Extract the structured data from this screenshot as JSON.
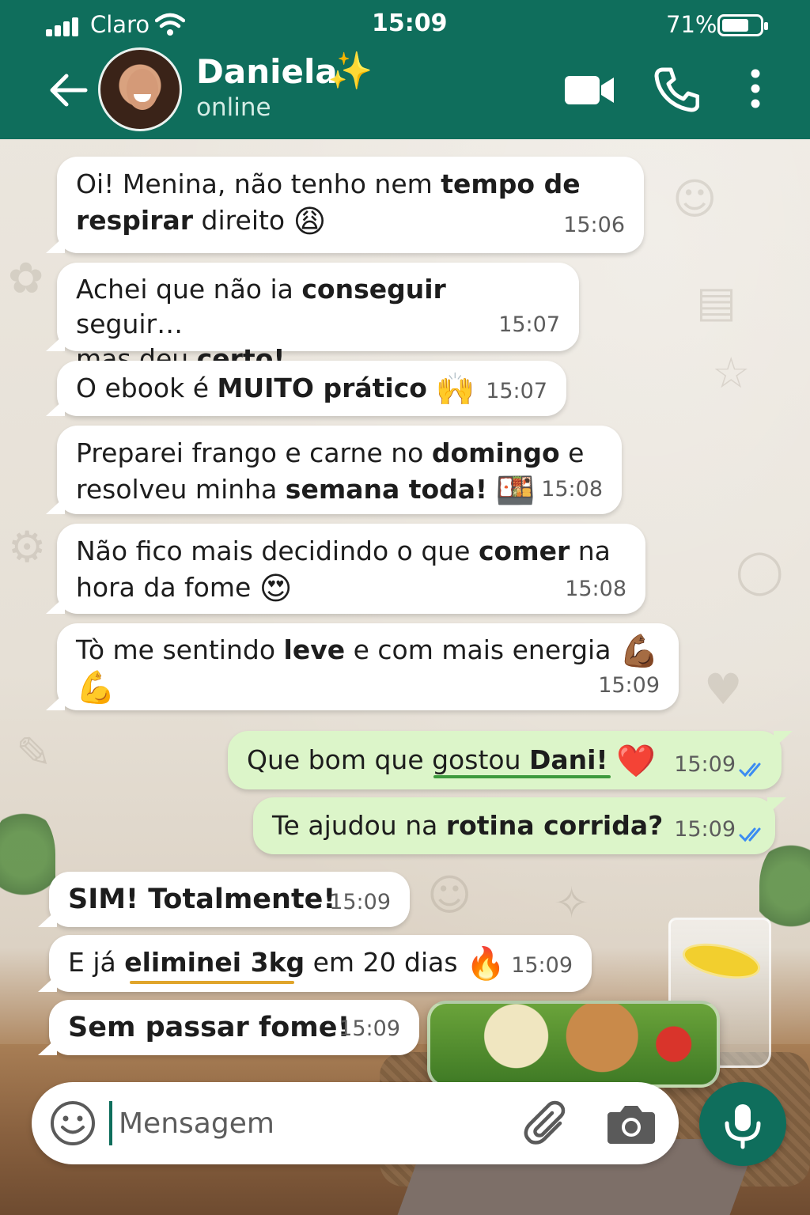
{
  "status_bar": {
    "carrier": "Claro",
    "time": "15:09",
    "battery": "71%",
    "battery_level": 0.71
  },
  "header": {
    "contact_name": "Daniela",
    "name_emoji": "✨",
    "status": "online",
    "icons": [
      "back-arrow-icon",
      "video-camera-icon",
      "phone-icon",
      "more-vertical-icon"
    ]
  },
  "messages": [
    {
      "dir": "in",
      "parts": [
        [
          "Oi! Menina, não tenho nem ",
          false
        ],
        [
          "tempo de",
          true
        ]
      ],
      "line2": [
        [
          "respirar",
          true
        ],
        [
          " direito ",
          false
        ]
      ],
      "emoji": "😩",
      "time": "15:06"
    },
    {
      "dir": "in",
      "line1": [
        [
          "Achei que não ia ",
          false
        ],
        [
          "conseguir",
          true
        ],
        [
          " seguir…",
          false
        ]
      ],
      "line2": [
        [
          "mas deu ",
          false
        ],
        [
          "certo!",
          true
        ]
      ],
      "time": "15:07"
    },
    {
      "dir": "in",
      "line1": [
        [
          "O ebook é ",
          false
        ],
        [
          "MUITO prático",
          true
        ]
      ],
      "emoji": "🙌",
      "time": "15:07"
    },
    {
      "dir": "in",
      "line1": [
        [
          "Preparei frango e carne no ",
          false
        ],
        [
          "domingo",
          true
        ],
        [
          " e",
          false
        ]
      ],
      "line2": [
        [
          "resolveu minha ",
          false
        ],
        [
          "semana toda!",
          true
        ]
      ],
      "emoji": "🍱",
      "time": "15:08"
    },
    {
      "dir": "in",
      "line1": [
        [
          "Não fico mais decidindo o que ",
          false
        ],
        [
          "comer",
          true
        ],
        [
          " na",
          false
        ]
      ],
      "line2": [
        [
          "hora da fome ",
          false
        ]
      ],
      "emoji": "😍",
      "time": "15:08"
    },
    {
      "dir": "in",
      "line1": [
        [
          "Tò me sentindo ",
          false
        ],
        [
          "leve",
          true
        ],
        [
          " e com mais energia",
          false
        ]
      ],
      "emoji": "💪🏾",
      "emoji2": "💪",
      "time": "15:09"
    },
    {
      "dir": "out",
      "line1": [
        [
          "Que bom que gostou ",
          false
        ],
        [
          "Dani!",
          true
        ]
      ],
      "emoji": "❤️",
      "time": "15:09"
    },
    {
      "dir": "out",
      "line1": [
        [
          "Te ajudou na ",
          false
        ],
        [
          "rotina corrida?",
          true
        ]
      ],
      "time": "15:09"
    },
    {
      "dir": "in",
      "line1": [
        [
          "SIM! Totalmente!",
          true
        ]
      ],
      "time": "15:09"
    },
    {
      "dir": "in",
      "line1": [
        [
          "E já ",
          false
        ],
        [
          "eliminei 3kg",
          true
        ],
        [
          " em 20 dias",
          false
        ]
      ],
      "emoji": "🔥",
      "time": "15:09"
    },
    {
      "dir": "in",
      "line1": [
        [
          "Sem passar fome!",
          true
        ]
      ],
      "time": "15:09"
    }
  ],
  "composer": {
    "placeholder": "Mensagem",
    "icons": [
      "emoji-smiley-icon",
      "paperclip-icon",
      "camera-icon",
      "microphone-icon"
    ]
  },
  "colors": {
    "header": "#0f6e5c",
    "incoming": "#ffffff",
    "outgoing": "#dcf5c9",
    "read_ticks": "#3b8cf2"
  }
}
